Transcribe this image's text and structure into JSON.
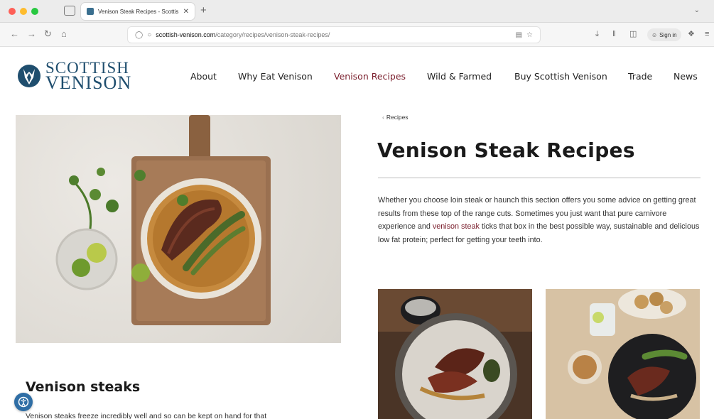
{
  "browser": {
    "tab_title": "Venison Steak Recipes - Scottis",
    "tab_close": "✕",
    "new_tab": "+",
    "url_domain": "scottish-venison.com",
    "url_path": "/category/recipes/venison-steak-recipes/",
    "signin_label": "Sign in"
  },
  "site": {
    "logo_line1": "SCOTTISH",
    "logo_line2": "VENISON",
    "brand_color": "#1f4e6e",
    "accent_color": "#7a1e2c",
    "nav": [
      {
        "label": "About"
      },
      {
        "label": "Why Eat Venison"
      },
      {
        "label": "Venison Recipes",
        "active": true
      },
      {
        "label": "Wild & Farmed"
      },
      {
        "label": "Buy Scottish Venison"
      },
      {
        "label": "Trade"
      },
      {
        "label": "News"
      }
    ]
  },
  "page": {
    "breadcrumb": "Recipes",
    "title": "Venison Steak Recipes",
    "intro_before": "Whether you choose loin steak or haunch this section offers you some advice on getting great results from these top of the range cuts. Sometimes you just want that pure carnivore experience and ",
    "intro_link": "venison steak",
    "intro_after": " ticks that box in the best possible way, sustainable and delicious low fat protein; perfect for getting your teeth into.",
    "section_heading": "Venison steaks",
    "section_text": "Venison steaks freeze incredibly well and so can be kept on hand for that"
  }
}
